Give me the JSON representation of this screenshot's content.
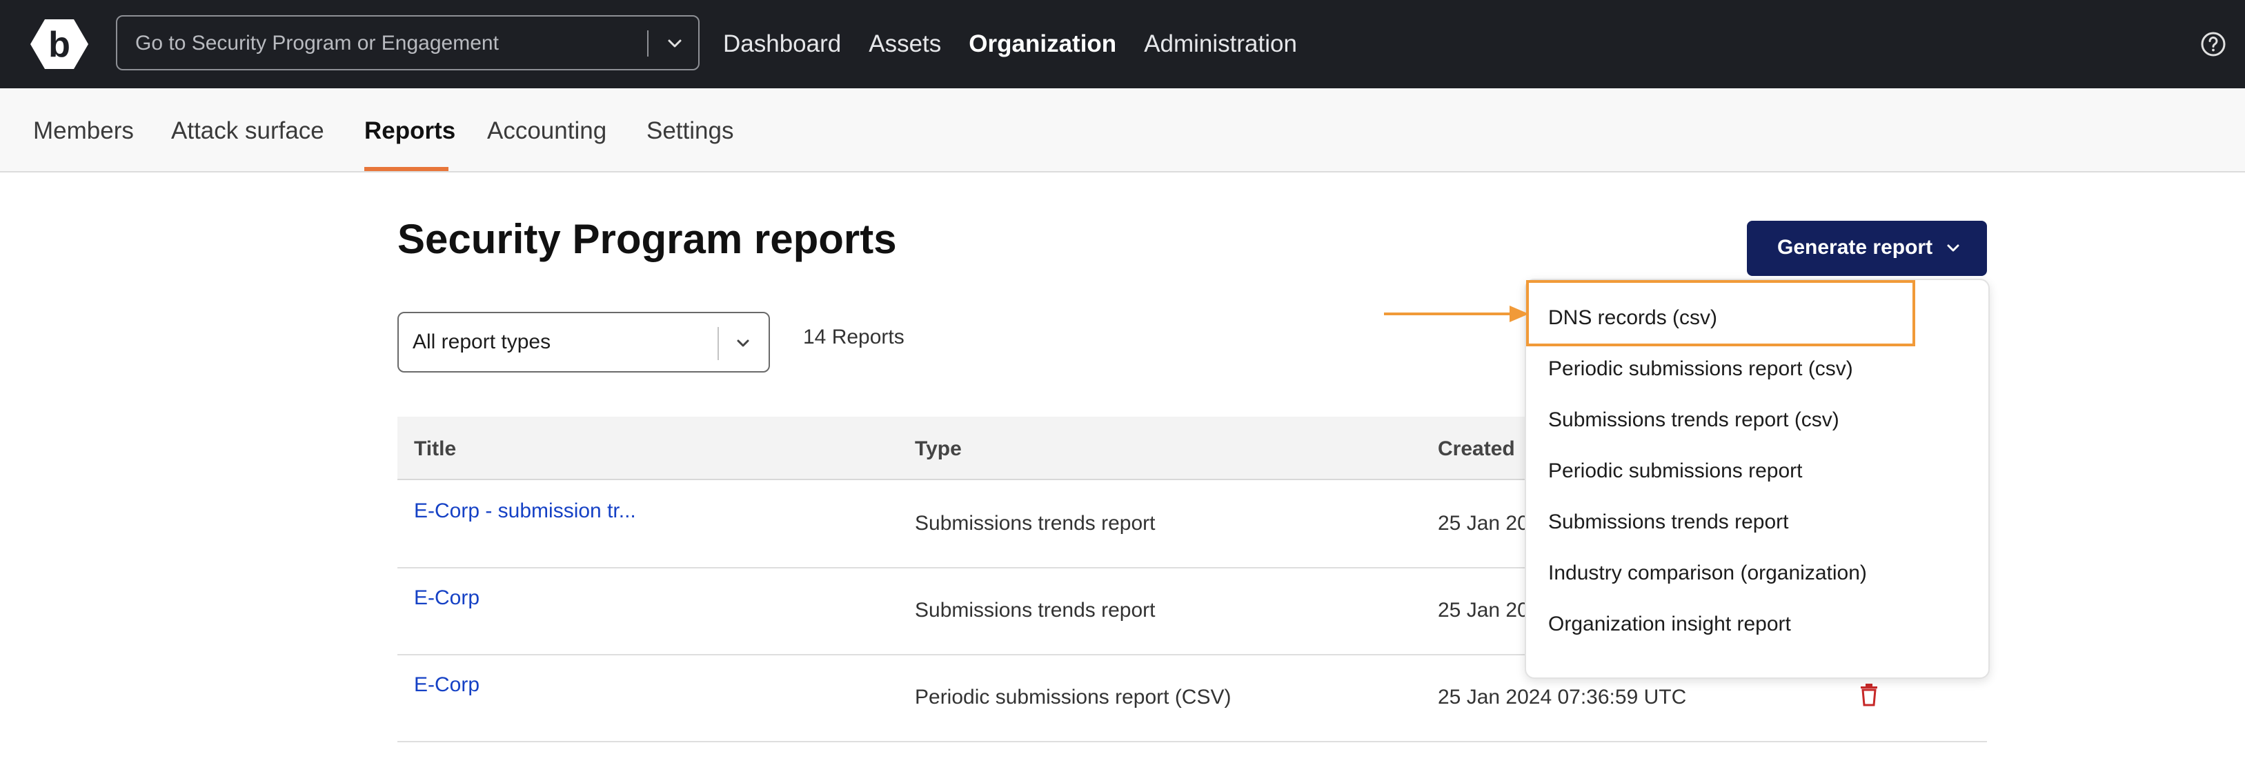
{
  "topbar": {
    "search_placeholder": "Go to Security Program or Engagement",
    "nav": [
      "Dashboard",
      "Assets",
      "Organization",
      "Administration"
    ],
    "active_nav": "Organization"
  },
  "subnav": {
    "tabs": [
      "Members",
      "Attack surface",
      "Reports",
      "Accounting",
      "Settings"
    ],
    "active_tab": "Reports"
  },
  "page": {
    "title": "Security Program reports",
    "filter_value": "All report types",
    "report_count": "14 Reports",
    "generate_button": "Generate report"
  },
  "table": {
    "headers": [
      "Title",
      "Type",
      "Created"
    ],
    "rows": [
      {
        "title": "E-Corp - submission tr...",
        "type": "Submissions trends report",
        "created": "25 Jan 20"
      },
      {
        "title": "E-Corp",
        "type": "Submissions trends report",
        "created": "25 Jan 20"
      },
      {
        "title": "E-Corp",
        "type": "Periodic submissions report (CSV)",
        "created": "25 Jan 2024 07:36:59 UTC"
      }
    ]
  },
  "dropdown": {
    "items": [
      "DNS records (csv)",
      "Periodic submissions report (csv)",
      "Submissions trends report (csv)",
      "Periodic submissions report",
      "Submissions trends report",
      "Industry comparison (organization)",
      "Organization insight report"
    ],
    "highlighted_item": "DNS records (csv)"
  },
  "colors": {
    "topbar": "#1d1f24",
    "primary_button": "#13205d",
    "accent_underline": "#e8763a",
    "highlight": "#f19a38",
    "link": "#1541c5",
    "delete": "#c62828"
  },
  "icons": {
    "logo": "bugcrowd-logo-icon",
    "search_dropdown": "chevron-down-icon",
    "help": "help-circle-icon",
    "delete": "trash-icon"
  }
}
